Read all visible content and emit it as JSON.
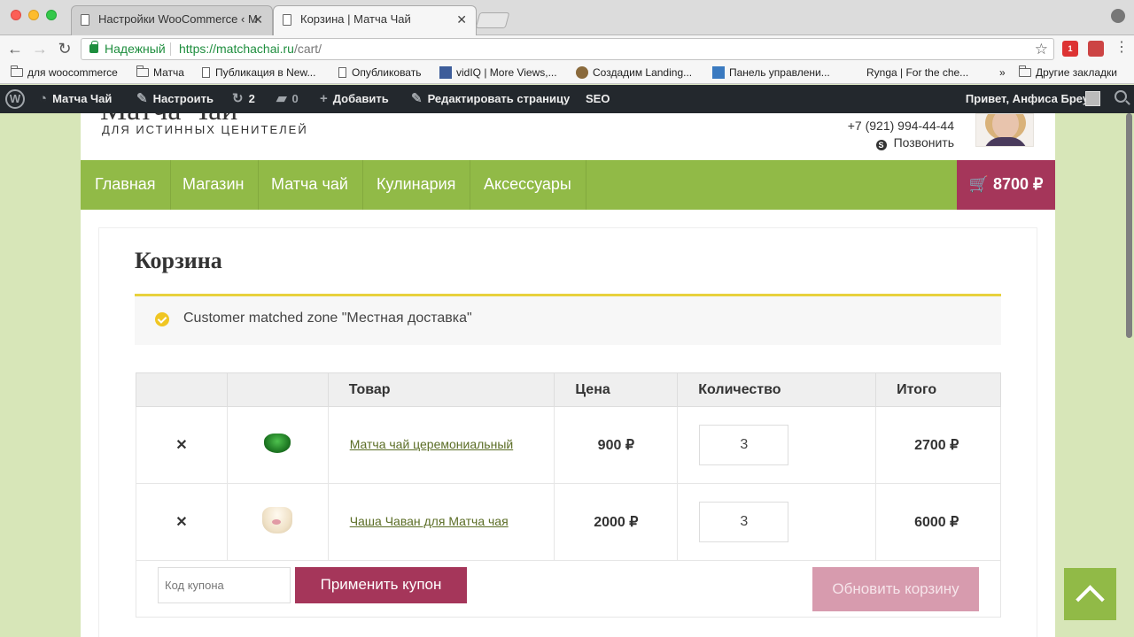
{
  "browser": {
    "tabs": [
      {
        "title": "Настройки WooCommerce ‹ М"
      },
      {
        "title": "Корзина | Матча Чай"
      }
    ],
    "secure_label": "Надежный",
    "url_host": "https://matchachai.ru",
    "url_path": "/cart/",
    "bookmarks": [
      "для woocommerce",
      "Матча",
      "Публикация в New...",
      "Опубликовать",
      "vidIQ | More Views,...",
      "Создадим Landing...",
      "Панель управлени...",
      "Rynga | For the che...",
      "»",
      "Другие закладки"
    ]
  },
  "wp_admin": {
    "site_name": "Матча Чай",
    "customize": "Настроить",
    "updates_count": "2",
    "comments_count": "0",
    "add_new": "Добавить",
    "edit_page": "Редактировать страницу",
    "seo": "SEO",
    "greeting": "Привет, Анфиса Бреус"
  },
  "header": {
    "logo_text": "Матча Чай",
    "tagline": "ДЛЯ ИСТИННЫХ ЦЕНИТЕЛЕЙ",
    "phone": "+7 (921) 994-44-44",
    "call_label": "Позвонить"
  },
  "nav": {
    "items": [
      "Главная",
      "Магазин",
      "Матча чай",
      "Кулинария",
      "Аксессуары"
    ],
    "cart_total": "8700 ₽"
  },
  "main": {
    "page_title": "Корзина",
    "notice": "Customer matched zone \"Местная доставка\"",
    "table": {
      "headers": [
        "",
        "",
        "Товар",
        "Цена",
        "Количество",
        "Итого"
      ],
      "rows": [
        {
          "name": "Матча чай церемониальный",
          "price": "900 ₽",
          "qty": "3",
          "total": "2700 ₽"
        },
        {
          "name": "Чаша Чаван для Матча чая",
          "price": "2000 ₽",
          "qty": "3",
          "total": "6000 ₽"
        }
      ]
    },
    "coupon_placeholder": "Код купона",
    "apply_coupon": "Применить купон",
    "update_cart": "Обновить корзину"
  },
  "colors": {
    "nav_green": "#91ba47",
    "accent_crimson": "#a5365a",
    "notice_yellow": "#e8d13d",
    "remove_red": "#c0152f"
  },
  "icons": [
    "wordpress-icon",
    "dashboard-icon",
    "brush-icon",
    "refresh-icon",
    "comment-icon",
    "plus-icon",
    "pencil-icon",
    "skype-icon",
    "cart-icon",
    "check-icon",
    "remove-icon",
    "arrow-up-icon",
    "search-icon",
    "star-icon",
    "lock-icon"
  ]
}
